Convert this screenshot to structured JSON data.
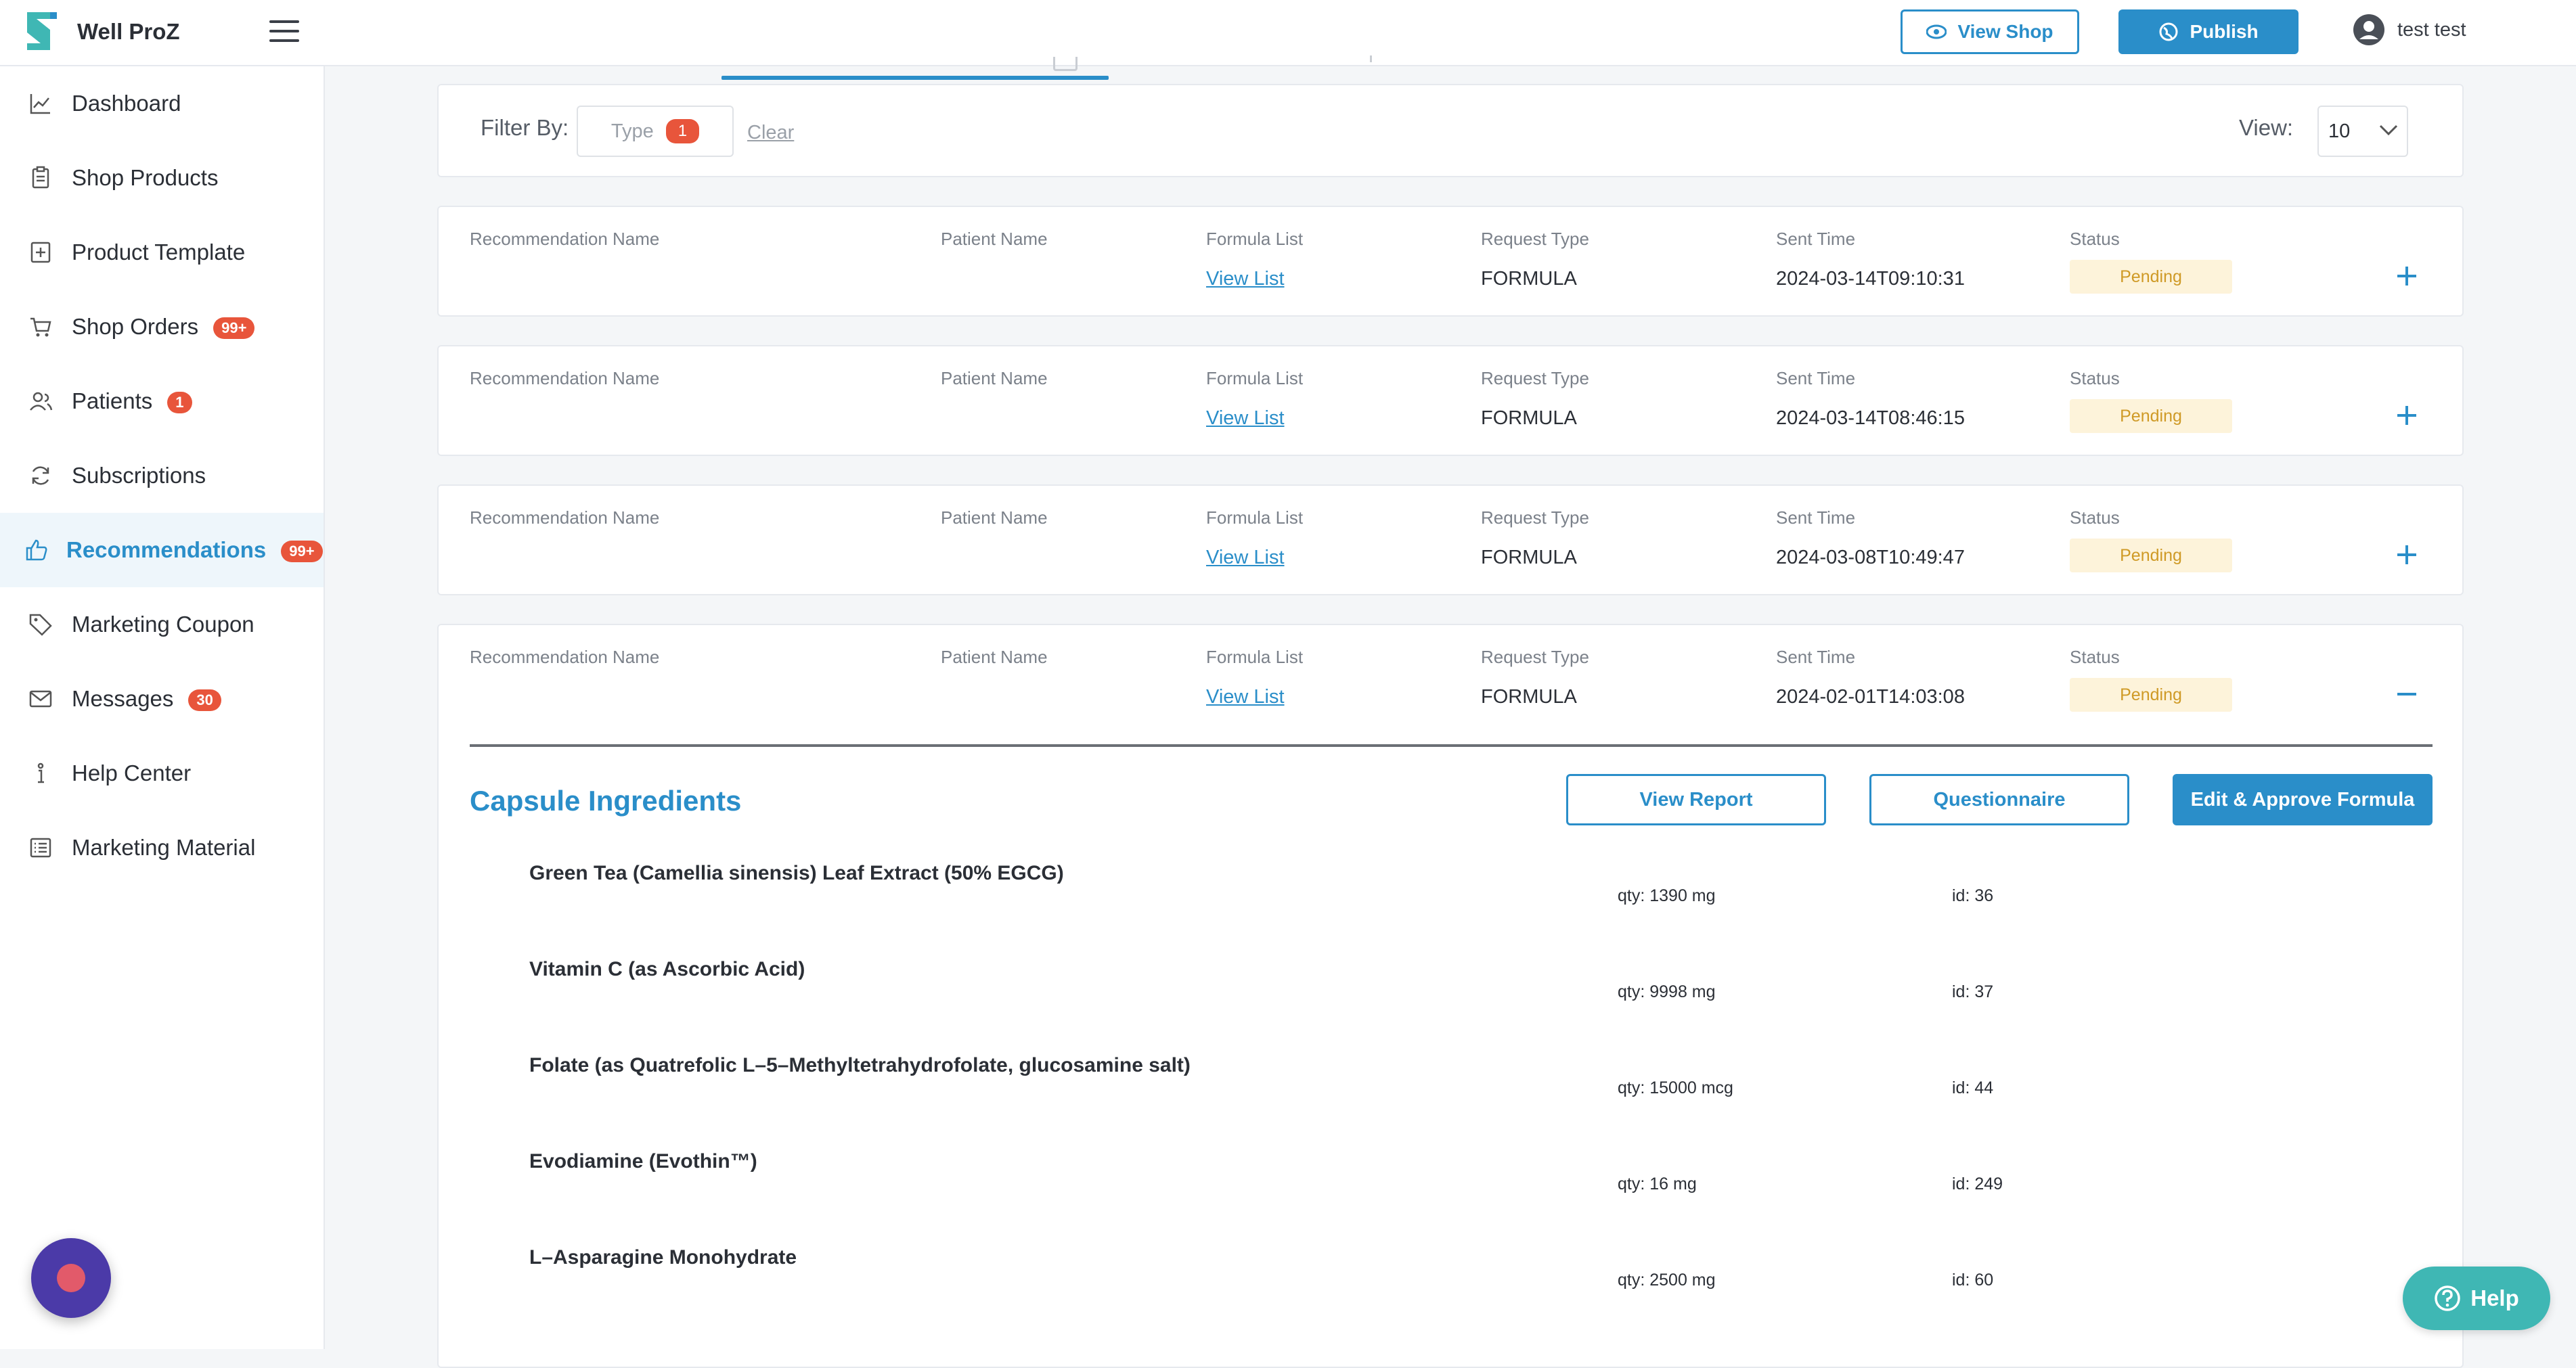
{
  "app": {
    "name": "Well ProZ"
  },
  "header": {
    "view_shop_label": "View Shop",
    "publish_label": "Publish",
    "user_name": "test test"
  },
  "sidebar": {
    "items": [
      {
        "label": "Dashboard",
        "icon": "chart-line-icon"
      },
      {
        "label": "Shop Products",
        "icon": "clipboard-icon"
      },
      {
        "label": "Product Template",
        "icon": "plus-box-icon"
      },
      {
        "label": "Shop Orders",
        "icon": "cart-icon",
        "badge": "99+"
      },
      {
        "label": "Patients",
        "icon": "users-icon",
        "badge": "1"
      },
      {
        "label": "Subscriptions",
        "icon": "refresh-icon"
      },
      {
        "label": "Recommendations",
        "icon": "thumbs-up-icon",
        "badge": "99+",
        "active": true
      },
      {
        "label": "Marketing Coupon",
        "icon": "tag-icon"
      },
      {
        "label": "Messages",
        "icon": "mail-icon",
        "badge": "30"
      },
      {
        "label": "Help Center",
        "icon": "info-icon"
      },
      {
        "label": "Marketing Material",
        "icon": "list-icon"
      }
    ]
  },
  "filter": {
    "label": "Filter By:",
    "type_label": "Type",
    "type_count": "1",
    "clear_label": "Clear",
    "view_label": "View:",
    "view_value": "10"
  },
  "columns": {
    "recommendation_name": "Recommendation Name",
    "patient_name": "Patient Name",
    "formula_list": "Formula List",
    "request_type": "Request Type",
    "sent_time": "Sent Time",
    "status": "Status"
  },
  "records": [
    {
      "recommendation_name": "",
      "patient_name": "",
      "formula_list": "View List",
      "request_type": "FORMULA",
      "sent_time": "2024-03-14T09:10:31",
      "status": "Pending",
      "expanded": false
    },
    {
      "recommendation_name": "",
      "patient_name": "",
      "formula_list": "View List",
      "request_type": "FORMULA",
      "sent_time": "2024-03-14T08:46:15",
      "status": "Pending",
      "expanded": false
    },
    {
      "recommendation_name": "",
      "patient_name": "",
      "formula_list": "View List",
      "request_type": "FORMULA",
      "sent_time": "2024-03-08T10:49:47",
      "status": "Pending",
      "expanded": false
    },
    {
      "recommendation_name": "",
      "patient_name": "",
      "formula_list": "View List",
      "request_type": "FORMULA",
      "sent_time": "2024-02-01T14:03:08",
      "status": "Pending",
      "expanded": true
    }
  ],
  "detail": {
    "title": "Capsule Ingredients",
    "view_report_label": "View Report",
    "questionnaire_label": "Questionnaire",
    "approve_label": "Edit & Approve Formula",
    "ingredients": [
      {
        "name": "Green Tea (Camellia sinensis) Leaf Extract (50% EGCG)",
        "qty": "qty: 1390 mg",
        "id": "id: 36"
      },
      {
        "name": "Vitamin C (as Ascorbic Acid)",
        "qty": "qty: 9998 mg",
        "id": "id: 37"
      },
      {
        "name": "Folate (as Quatrefolic L–5–Methyltetrahydrofolate, glucosamine salt)",
        "qty": "qty: 15000 mcg",
        "id": "id: 44"
      },
      {
        "name": "Evodiamine (Evothin™)",
        "qty": "qty: 16 mg",
        "id": "id: 249"
      },
      {
        "name": "L–Asparagine Monohydrate",
        "qty": "qty: 2500 mg",
        "id": "id: 60"
      }
    ]
  },
  "help": {
    "label": "Help"
  },
  "colors": {
    "accent": "#2a8ec9",
    "badge": "#e8553b",
    "pending_bg": "#fdf3da",
    "pending_text": "#cf9a26",
    "help": "#3fb7b4"
  }
}
